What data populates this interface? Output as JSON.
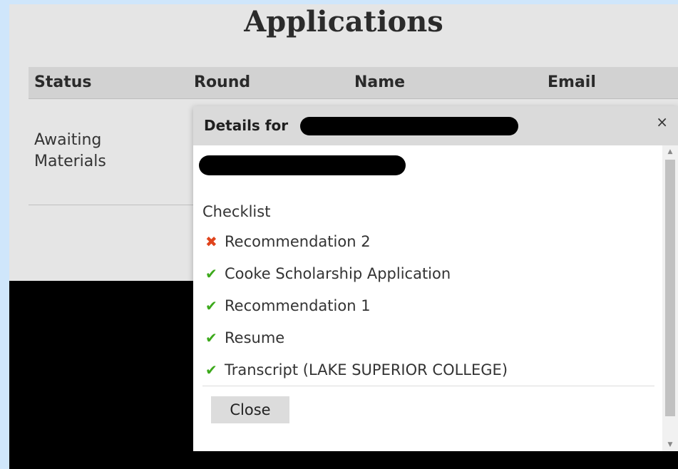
{
  "page": {
    "title": "Applications"
  },
  "table": {
    "headers": [
      "Status",
      "Round",
      "Name",
      "Email"
    ],
    "rows": [
      {
        "status_line1": "Awaiting",
        "status_line2": "Materials"
      }
    ]
  },
  "modal": {
    "title_prefix": "Details for",
    "close_symbol": "×",
    "checklist_title": "Checklist",
    "items": [
      {
        "label": "Recommendation 2",
        "done": false,
        "icon": "cross-icon",
        "symbol": "✖"
      },
      {
        "label": "Cooke Scholarship Application",
        "done": true,
        "icon": "check-icon",
        "symbol": "✔"
      },
      {
        "label": "Recommendation 1",
        "done": true,
        "icon": "check-icon",
        "symbol": "✔"
      },
      {
        "label": "Resume",
        "done": true,
        "icon": "check-icon",
        "symbol": "✔"
      },
      {
        "label": "Transcript (LAKE SUPERIOR COLLEGE)",
        "done": true,
        "icon": "check-icon",
        "symbol": "✔"
      }
    ],
    "close_button_label": "Close"
  },
  "colors": {
    "incomplete": "#e0441c",
    "complete": "#3ca91b"
  }
}
